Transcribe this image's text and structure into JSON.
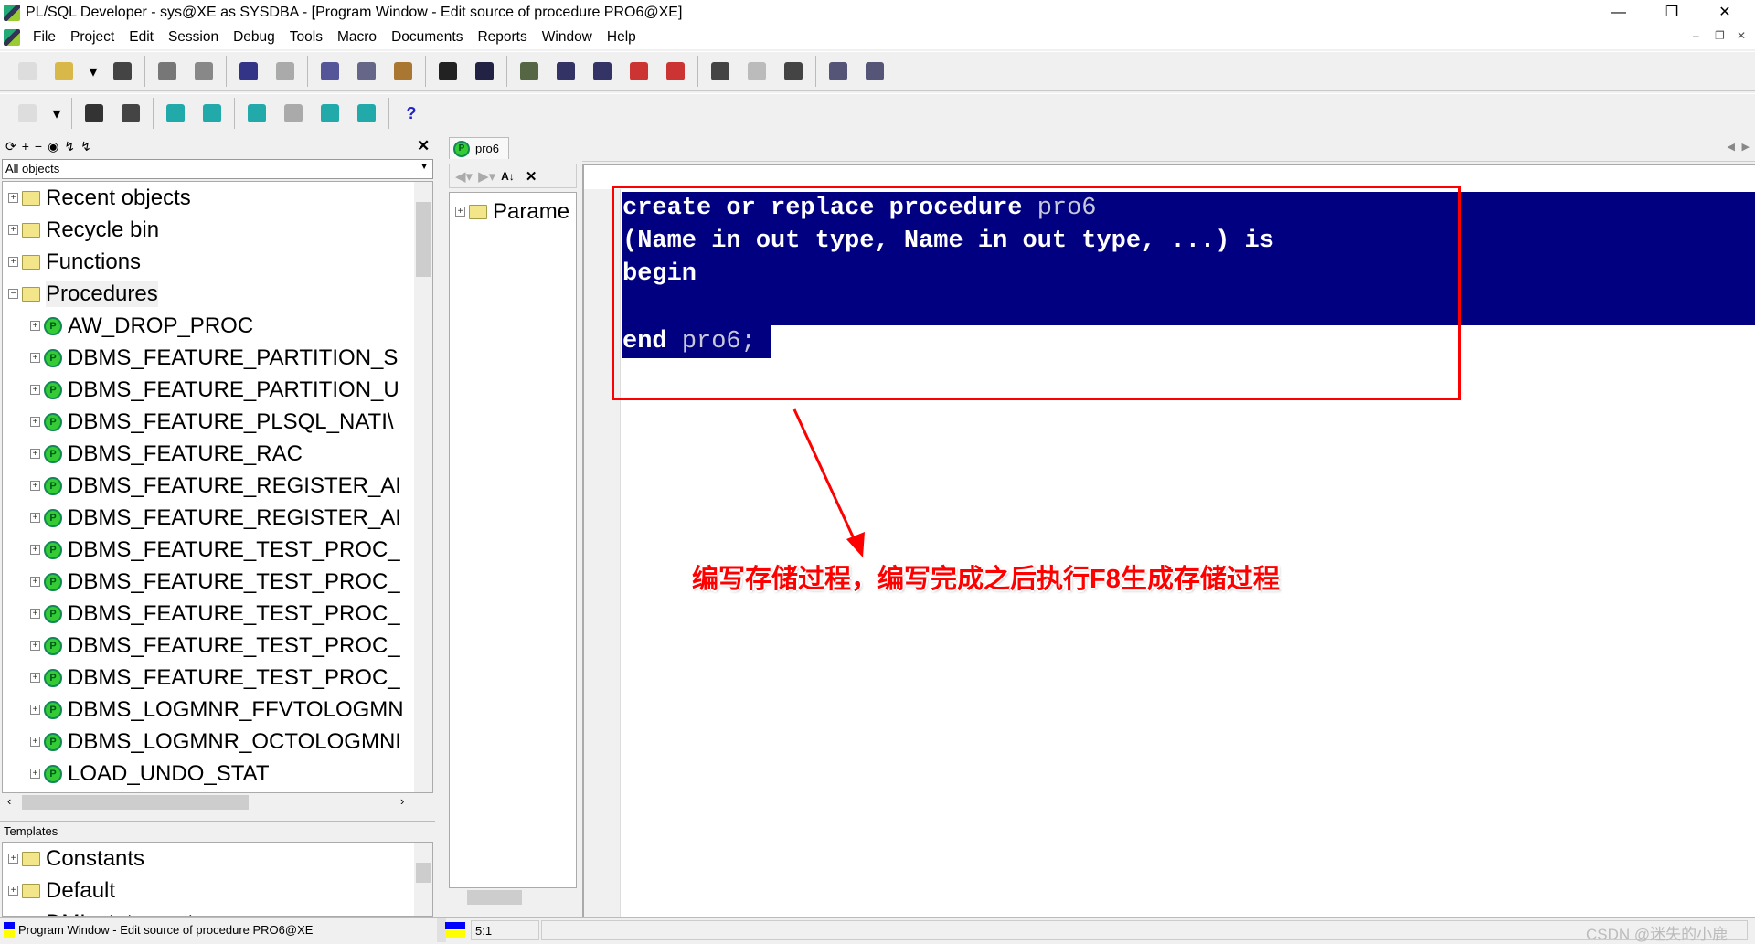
{
  "window": {
    "title": "PL/SQL Developer - sys@XE as SYSDBA - [Program Window - Edit source of procedure PRO6@XE]"
  },
  "menu": [
    "File",
    "Project",
    "Edit",
    "Session",
    "Debug",
    "Tools",
    "Macro",
    "Documents",
    "Reports",
    "Window",
    "Help"
  ],
  "toolbar1": [
    "new-icon",
    "open-icon",
    "dropdown-icon",
    "save-icon",
    "print-icon",
    "print-preview-icon",
    "undo-icon",
    "redo-icon",
    "cut-icon",
    "copy-icon",
    "paste-icon",
    "find-icon",
    "find-next-icon",
    "check-icon",
    "indent-icon",
    "unindent-icon",
    "comment-icon",
    "uncomment-icon",
    "record-macro-icon",
    "play-macro-icon",
    "macro-library-icon",
    "window-list-icon",
    "tile-icon"
  ],
  "toolbar2": [
    "key-icon",
    "dropdown-icon",
    "execute-gear-icon",
    "break-icon",
    "fetch-icon",
    "commit-icon",
    "db-light-icon",
    "sql-icon",
    "db-find-icon",
    "db-rollback-icon",
    "help-icon"
  ],
  "object_browser": {
    "filter": "All objects",
    "folders": [
      "Recent objects",
      "Recycle bin",
      "Functions",
      "Procedures"
    ],
    "procedures": [
      "AW_DROP_PROC",
      "DBMS_FEATURE_PARTITION_S",
      "DBMS_FEATURE_PARTITION_U",
      "DBMS_FEATURE_PLSQL_NATI\\",
      "DBMS_FEATURE_RAC",
      "DBMS_FEATURE_REGISTER_AI",
      "DBMS_FEATURE_REGISTER_AI",
      "DBMS_FEATURE_TEST_PROC_",
      "DBMS_FEATURE_TEST_PROC_",
      "DBMS_FEATURE_TEST_PROC_",
      "DBMS_FEATURE_TEST_PROC_",
      "DBMS_FEATURE_TEST_PROC_",
      "DBMS_LOGMNR_FFVTOLOGMN",
      "DBMS_LOGMNR_OCTOLOGMNI",
      "LOAD_UNDO_STAT"
    ]
  },
  "templates": {
    "label": "Templates",
    "items": [
      "Constants",
      "Default",
      "DML statements"
    ]
  },
  "tab": {
    "label": "pro6"
  },
  "outline": {
    "item": "Parame"
  },
  "code": {
    "l1a": "create or replace procedure ",
    "l1b": "pro6",
    "l2": "(Name in out type, Name in out type, ...) is",
    "l3": "begin",
    "l5a": "end ",
    "l5b": "pro6;"
  },
  "annotation": "编写存储过程，编写完成之后执行F8生成存储过程",
  "status": {
    "left": "Program Window - Edit source of procedure PRO6@XE",
    "position": "5:1"
  },
  "watermark": "CSDN @迷失的小鹿",
  "colors": {
    "selection": "#000080",
    "annotation": "#ff0000"
  }
}
